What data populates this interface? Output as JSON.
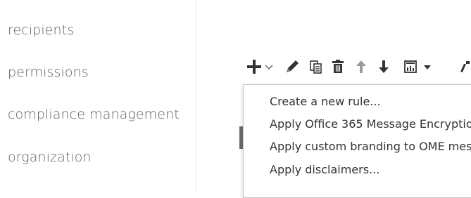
{
  "nav": {
    "items": [
      {
        "label": "recipients"
      },
      {
        "label": "permissions"
      },
      {
        "label": "compliance management"
      },
      {
        "label": "organization"
      }
    ]
  },
  "toolbar": {
    "icons": [
      "add-icon",
      "chevron-down-icon",
      "edit-icon",
      "copy-icon",
      "delete-icon",
      "arrow-up-icon",
      "arrow-down-icon",
      "report-icon",
      "chevron-down-icon",
      "more-icon"
    ]
  },
  "menu": {
    "items": [
      {
        "label": "Create a new rule..."
      },
      {
        "label": "Apply Office 365 Message Encryptio"
      },
      {
        "label": "Apply custom branding to OME mes"
      },
      {
        "label": "Apply disclaimers..."
      }
    ]
  },
  "colors": {
    "nav_text": "#5f5f5f",
    "icon_dark": "#333333",
    "icon_light": "#9a9a9a",
    "menu_border": "#c8c8c8"
  }
}
